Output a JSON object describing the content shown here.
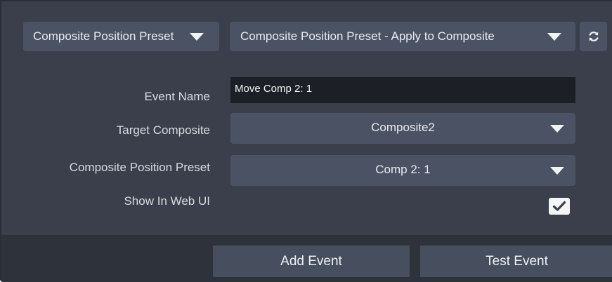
{
  "header": {
    "category_dropdown": {
      "selected": "Composite Position Preset"
    },
    "action_dropdown": {
      "selected": "Composite Position Preset - Apply to Composite"
    },
    "refresh_icon": "refresh-icon"
  },
  "form": {
    "event_name": {
      "label": "Event Name",
      "value": "Move Comp 2: 1"
    },
    "target_composite": {
      "label": "Target Composite",
      "selected": "Composite2"
    },
    "position_preset": {
      "label": "Composite Position Preset",
      "selected": "Comp 2: 1"
    },
    "show_in_web_ui": {
      "label": "Show In Web UI",
      "checked": true
    }
  },
  "footer": {
    "add_event_label": "Add Event",
    "test_event_label": "Test Event"
  },
  "colors": {
    "panel_bg": "#3a3f4b",
    "control_bg": "#4b5263",
    "input_bg": "#1c1f25",
    "footer_bg": "#2e323b"
  }
}
